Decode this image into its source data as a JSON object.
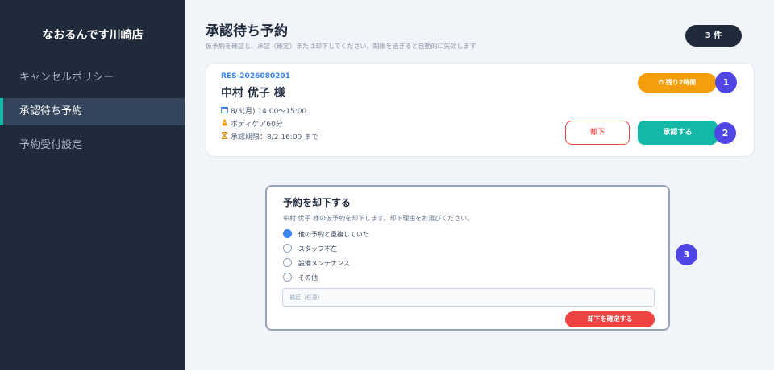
{
  "sidebar": {
    "brand": "なおるんです川崎店",
    "items": [
      {
        "label": "キャンセルポリシー",
        "active": false
      },
      {
        "label": "承認待ち予約",
        "active": true
      },
      {
        "label": "予約受付設定",
        "active": false
      }
    ]
  },
  "header": {
    "title": "承認待ち予約",
    "subtitle": "仮予約を確認し、承認（確定）または却下してください。期限を過ぎると自動的に失効します",
    "count_badge": "3 件"
  },
  "reservation": {
    "id": "RES-2026080201",
    "customer": "中村 优子 様",
    "datetime": "8/3(月) 14:00〜15:00",
    "service": "ボディケア60分",
    "deadline": "承認期限：8/2 16:00 まで",
    "timer_badge": "⏱ 残り2時間",
    "reject_label": "却下",
    "approve_label": "承認する"
  },
  "markers": [
    "1",
    "2",
    "3"
  ],
  "modal": {
    "title": "予約を却下する",
    "description": "中村 优子 様の仮予約を却下します。却下理由をお選びください。",
    "options": [
      {
        "label": "他の予約と重複していた",
        "checked": true
      },
      {
        "label": "スタッフ不在",
        "checked": false
      },
      {
        "label": "設備メンテナンス",
        "checked": false
      },
      {
        "label": "その他",
        "checked": false
      }
    ],
    "note_placeholder": "補足（任意）",
    "confirm_label": "却下を確定する"
  },
  "colors": {
    "sidebar_bg": "#1f2a3a",
    "accent": "#14b8a6",
    "danger": "#ef4444",
    "warning": "#f59e0b",
    "marker": "#4f46e5",
    "link": "#3b82f6"
  }
}
